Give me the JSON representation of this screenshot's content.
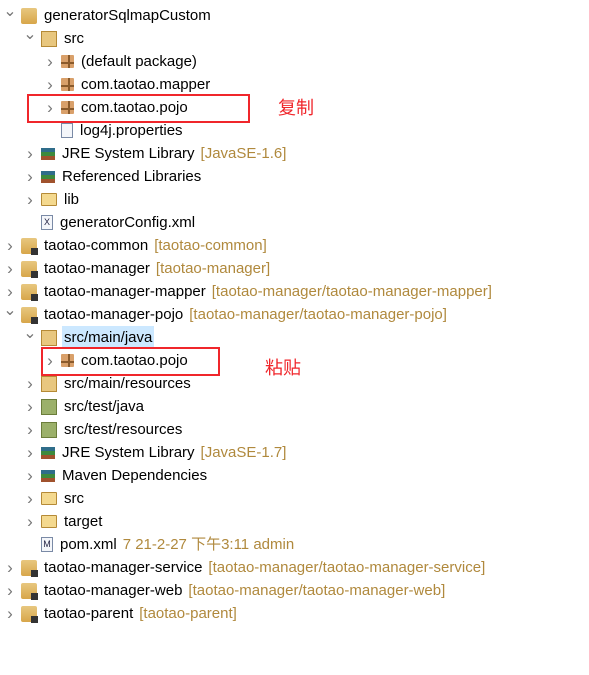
{
  "tree": [
    {
      "level": 0,
      "expand": "open",
      "icon": "project-icon",
      "label": "generatorSqlmapCustom",
      "deco": ""
    },
    {
      "level": 1,
      "expand": "open",
      "icon": "source-folder-icon",
      "label": "src",
      "deco": ""
    },
    {
      "level": 2,
      "expand": "closed",
      "icon": "package-icon",
      "label": "(default package)",
      "deco": ""
    },
    {
      "level": 2,
      "expand": "closed",
      "icon": "package-icon",
      "label": "com.taotao.mapper",
      "deco": ""
    },
    {
      "level": 2,
      "expand": "closed",
      "icon": "package-icon",
      "label": "com.taotao.pojo",
      "deco": ""
    },
    {
      "level": 2,
      "expand": "none",
      "icon": "properties-file-icon",
      "label": "log4j.properties",
      "deco": ""
    },
    {
      "level": 1,
      "expand": "closed",
      "icon": "library-icon",
      "label": "JRE System Library",
      "deco": "[JavaSE-1.6]"
    },
    {
      "level": 1,
      "expand": "closed",
      "icon": "library-icon",
      "label": "Referenced Libraries",
      "deco": ""
    },
    {
      "level": 1,
      "expand": "closed",
      "icon": "folder-icon",
      "label": "lib",
      "deco": ""
    },
    {
      "level": 1,
      "expand": "none",
      "icon": "xml-file-icon",
      "label": "generatorConfig.xml",
      "deco": ""
    },
    {
      "level": 0,
      "expand": "closed",
      "icon": "maven-project-icon",
      "label": "taotao-common",
      "deco": "[taotao-common]"
    },
    {
      "level": 0,
      "expand": "closed",
      "icon": "maven-project-icon",
      "label": "taotao-manager",
      "deco": "[taotao-manager]"
    },
    {
      "level": 0,
      "expand": "closed",
      "icon": "maven-project-icon",
      "label": "taotao-manager-mapper",
      "deco": "[taotao-manager/taotao-manager-mapper]"
    },
    {
      "level": 0,
      "expand": "open",
      "icon": "maven-project-icon",
      "label": "taotao-manager-pojo",
      "deco": "[taotao-manager/taotao-manager-pojo]"
    },
    {
      "level": 1,
      "expand": "open",
      "icon": "source-folder-icon",
      "label": "src/main/java",
      "deco": "",
      "selected": true
    },
    {
      "level": 2,
      "expand": "closed",
      "icon": "package-icon",
      "label": "com.taotao.pojo",
      "deco": ""
    },
    {
      "level": 1,
      "expand": "closed",
      "icon": "source-folder-icon",
      "label": "src/main/resources",
      "deco": ""
    },
    {
      "level": 1,
      "expand": "closed",
      "icon": "test-source-folder-icon",
      "label": "src/test/java",
      "deco": ""
    },
    {
      "level": 1,
      "expand": "closed",
      "icon": "test-source-folder-icon",
      "label": "src/test/resources",
      "deco": ""
    },
    {
      "level": 1,
      "expand": "closed",
      "icon": "library-icon",
      "label": "JRE System Library",
      "deco": "[JavaSE-1.7]"
    },
    {
      "level": 1,
      "expand": "closed",
      "icon": "library-icon",
      "label": "Maven Dependencies",
      "deco": ""
    },
    {
      "level": 1,
      "expand": "closed",
      "icon": "folder-icon",
      "label": "src",
      "deco": ""
    },
    {
      "level": 1,
      "expand": "closed",
      "icon": "folder-icon",
      "label": "target",
      "deco": ""
    },
    {
      "level": 1,
      "expand": "none",
      "icon": "pom-file-icon",
      "label": "pom.xml",
      "deco": "7  21-2-27 下午3:11  admin"
    },
    {
      "level": 0,
      "expand": "closed",
      "icon": "maven-project-icon",
      "label": "taotao-manager-service",
      "deco": "[taotao-manager/taotao-manager-service]"
    },
    {
      "level": 0,
      "expand": "closed",
      "icon": "maven-project-icon",
      "label": "taotao-manager-web",
      "deco": "[taotao-manager/taotao-manager-web]"
    },
    {
      "level": 0,
      "expand": "closed",
      "icon": "maven-project-icon",
      "label": "taotao-parent",
      "deco": "[taotao-parent]"
    }
  ],
  "annotations": {
    "copy": "复制",
    "paste": "粘贴"
  },
  "colors": {
    "highlight": "#f0262b",
    "decoration": "#b0893d",
    "selection": "#cce8ff"
  }
}
